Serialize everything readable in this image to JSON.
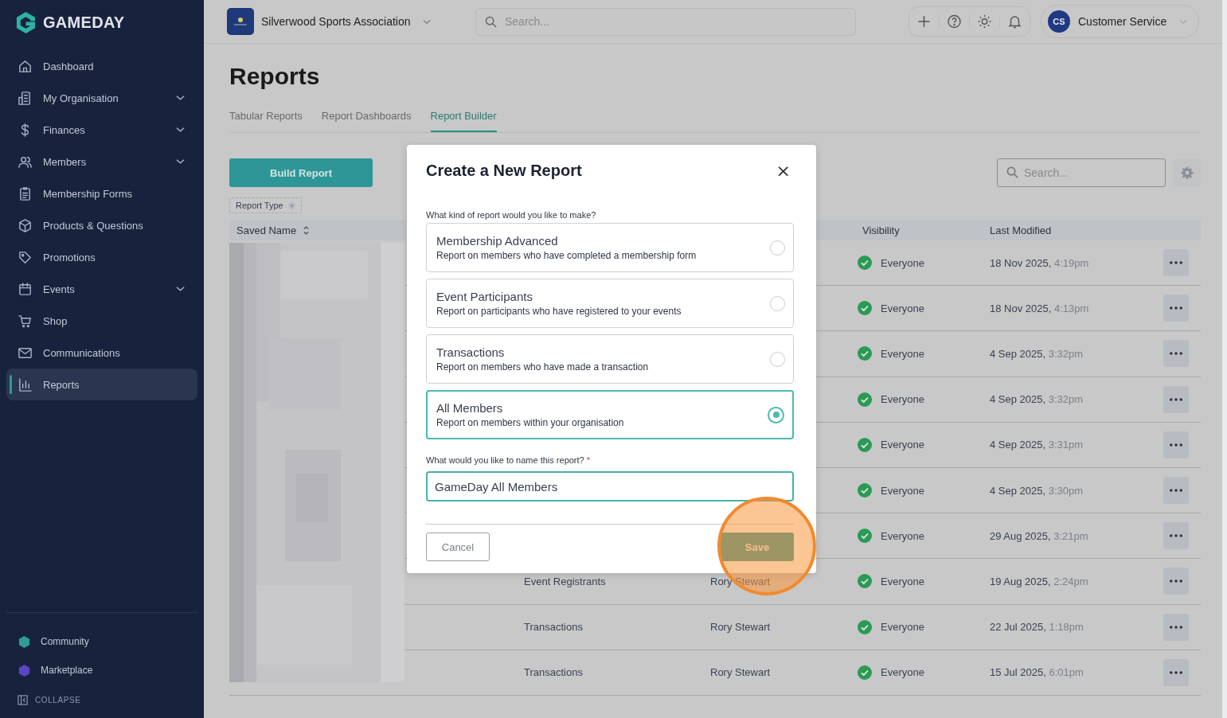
{
  "sidebar": {
    "logo": "GAMEDAY",
    "items": [
      {
        "label": "Dashboard",
        "expandable": false,
        "selected": false
      },
      {
        "label": "My Organisation",
        "expandable": true,
        "selected": false
      },
      {
        "label": "Finances",
        "expandable": true,
        "selected": false
      },
      {
        "label": "Members",
        "expandable": true,
        "selected": false
      },
      {
        "label": "Membership Forms",
        "expandable": false,
        "selected": false
      },
      {
        "label": "Products & Questions",
        "expandable": false,
        "selected": false
      },
      {
        "label": "Promotions",
        "expandable": false,
        "selected": false
      },
      {
        "label": "Events",
        "expandable": true,
        "selected": false
      },
      {
        "label": "Shop",
        "expandable": false,
        "selected": false
      },
      {
        "label": "Communications",
        "expandable": false,
        "selected": false
      },
      {
        "label": "Reports",
        "expandable": false,
        "selected": true
      }
    ],
    "footer_links": [
      {
        "label": "Community",
        "color": "#2f9c95"
      },
      {
        "label": "Marketplace",
        "color": "#5b45c4"
      }
    ],
    "collapse": "COLLAPSE"
  },
  "topbar": {
    "organisation": "Silverwood Sports Association",
    "search": {
      "placeholder": "Search..."
    },
    "user": {
      "initials": "CS",
      "name": "Customer Service"
    }
  },
  "page": {
    "title": "Reports",
    "tabs": [
      {
        "label": "Tabular Reports",
        "selected": false
      },
      {
        "label": "Report Dashboards",
        "selected": false
      },
      {
        "label": "Report Builder",
        "selected": true
      }
    ],
    "build_button": "Build Report",
    "search": {
      "placeholder": "Search..."
    },
    "filter_chip": "Report Type",
    "columns": {
      "saved_name": "Saved Name",
      "visibility": "Visibility",
      "last_modified": "Last Modified"
    },
    "rows": [
      {
        "visibility": "Everyone",
        "date": "18 Nov 2025,",
        "time": "4:19pm"
      },
      {
        "visibility": "Everyone",
        "date": "18 Nov 2025,",
        "time": "4:13pm"
      },
      {
        "visibility": "Everyone",
        "date": "4 Sep 2025,",
        "time": "3:32pm"
      },
      {
        "visibility": "Everyone",
        "date": "4 Sep 2025,",
        "time": "3:32pm"
      },
      {
        "visibility": "Everyone",
        "date": "4 Sep 2025,",
        "time": "3:31pm"
      },
      {
        "visibility": "Everyone",
        "date": "4 Sep 2025,",
        "time": "3:30pm"
      },
      {
        "visibility": "Everyone",
        "date": "29 Aug 2025,",
        "time": "3:21pm"
      },
      {
        "report_type": "Event Registrants",
        "created_by": "Rory Stewart",
        "visibility": "Everyone",
        "date": "19 Aug 2025,",
        "time": "2:24pm"
      },
      {
        "report_type": "Transactions",
        "created_by": "Rory Stewart",
        "visibility": "Everyone",
        "date": "22 Jul 2025,",
        "time": "1:18pm"
      },
      {
        "report_type": "Transactions",
        "created_by": "Rory Stewart",
        "visibility": "Everyone",
        "date": "15 Jul 2025,",
        "time": "6:01pm"
      }
    ]
  },
  "modal": {
    "title": "Create a New Report",
    "close": "×",
    "question": "What kind of report would you like to make?",
    "options": [
      {
        "title": "Membership Advanced",
        "description": "Report on members who have completed a membership form",
        "selected": false
      },
      {
        "title": "Event Participants",
        "description": "Report on participants who have registered to your events",
        "selected": false
      },
      {
        "title": "Transactions",
        "description": "Report on members who have made a transaction",
        "selected": false
      },
      {
        "title": "All Members",
        "description": "Report on members within your organisation",
        "selected": true
      }
    ],
    "name_label": "What would you like to name this report?",
    "required_mark": "*",
    "name_value": "GameDay All Members",
    "cancel": "Cancel",
    "save": "Save",
    "save_highlighted": true
  }
}
